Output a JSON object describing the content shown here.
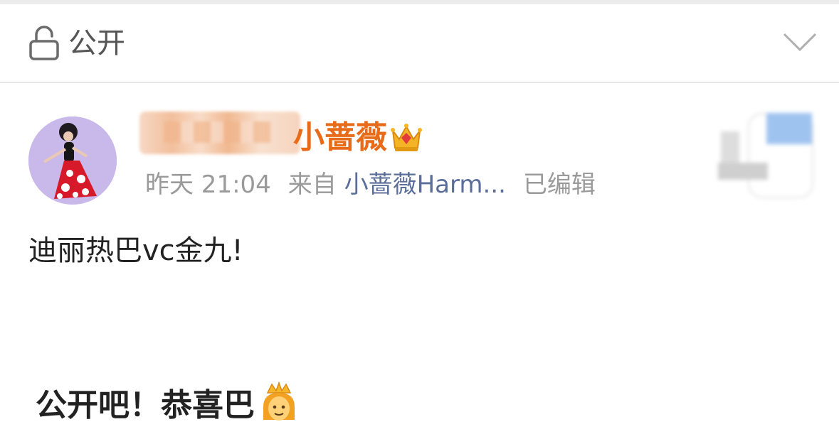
{
  "visibility": {
    "label": "公开",
    "lock_icon": "lock-icon",
    "expand_icon": "chevron-down-icon"
  },
  "post": {
    "author": {
      "name_visible": "小蔷薇",
      "badge_icon": "crown-icon",
      "avatar_icon": "avatar"
    },
    "meta": {
      "time": "昨天 21:04",
      "source_prefix": "来自",
      "source": "小蔷薇Harm...",
      "edited": "已编辑"
    },
    "text_line1": "迪丽热巴vc金九!",
    "text_line2": "公开吧！恭喜巴",
    "text_line2_emoji": "princess-icon"
  },
  "colors": {
    "username": "#e86b1a",
    "source_link": "#5b6e9a",
    "meta_text": "#9a9a9a",
    "body_text": "#222222"
  }
}
